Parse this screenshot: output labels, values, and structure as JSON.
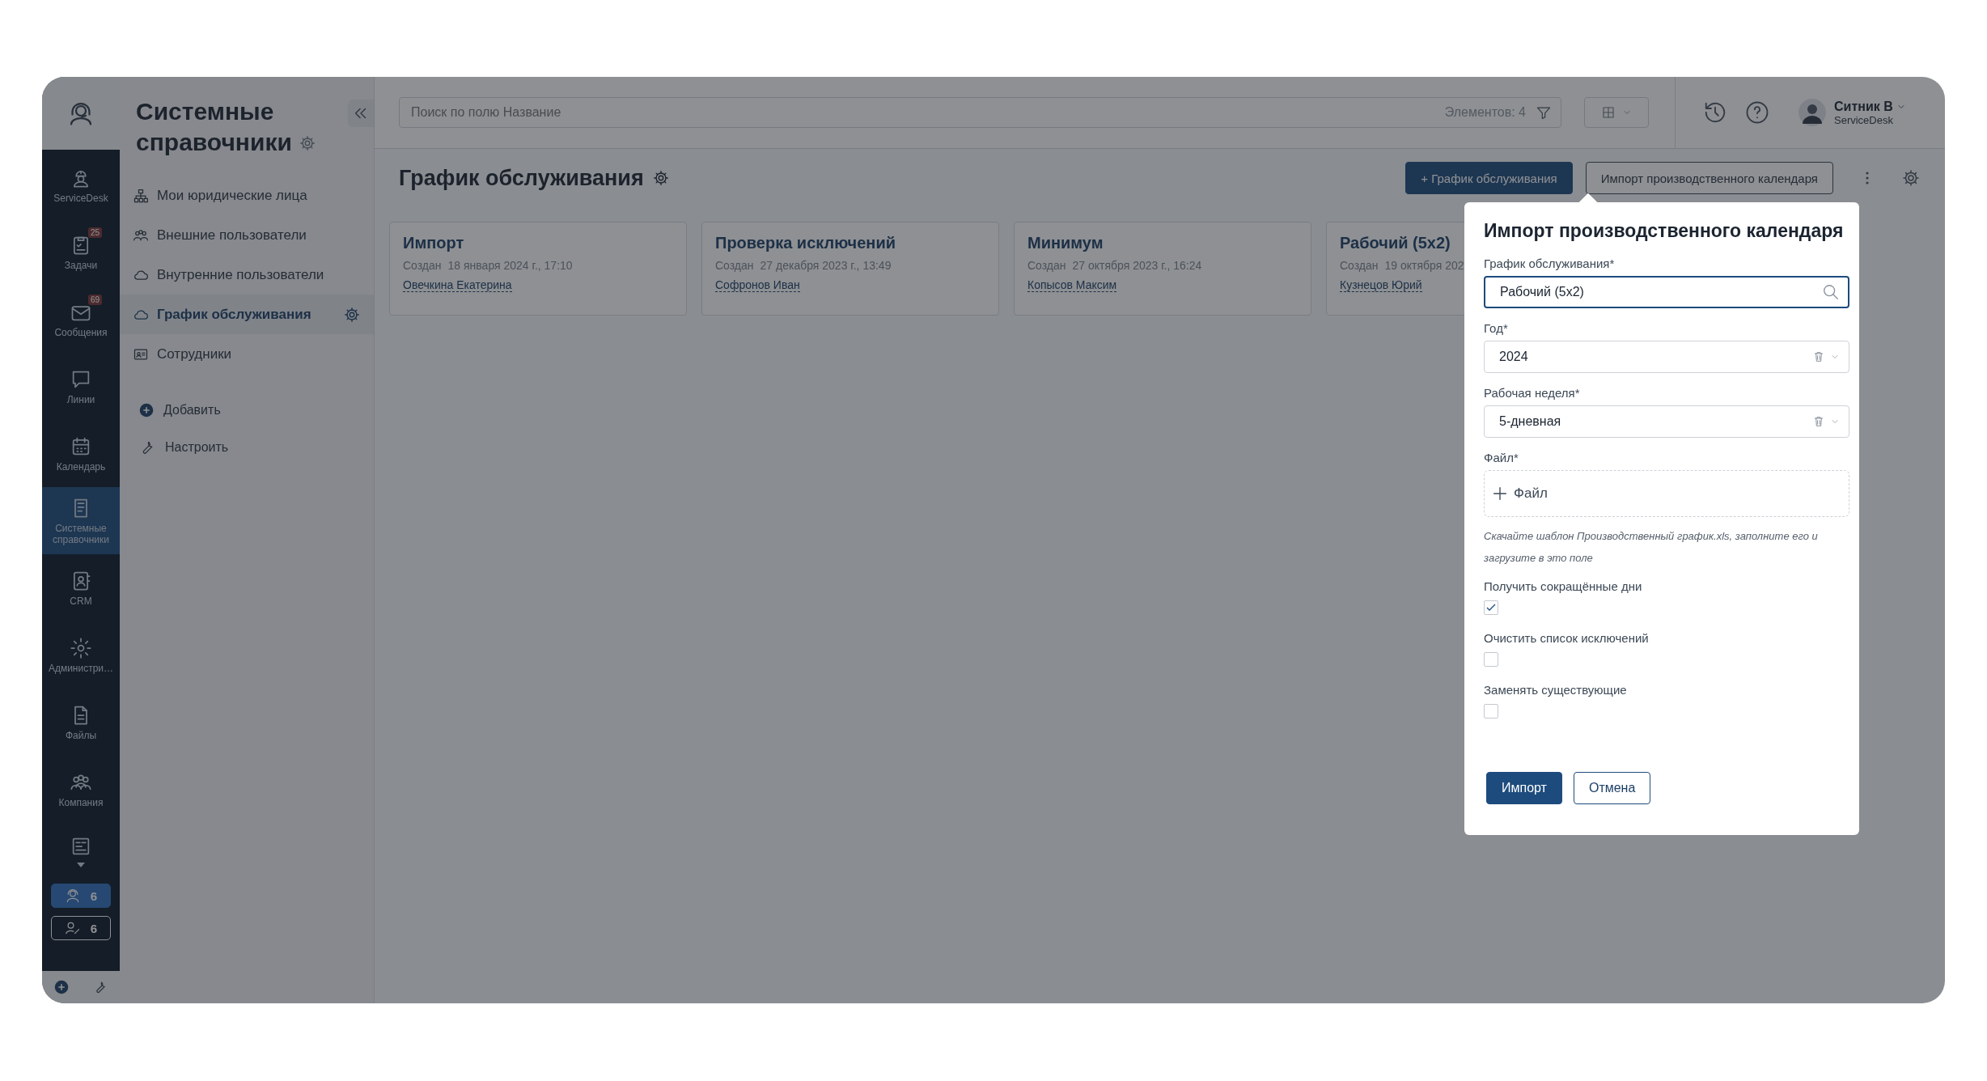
{
  "nav": {
    "items": [
      {
        "label": "ServiceDesk",
        "selected": false
      },
      {
        "label": "Задачи",
        "badge": "25",
        "selected": false
      },
      {
        "label": "Сообщения",
        "badge": "69",
        "selected": false
      },
      {
        "label": "Линии",
        "selected": false
      },
      {
        "label": "Календарь",
        "selected": false
      },
      {
        "label": "Системные справочники",
        "selected": true
      },
      {
        "label": "CRM",
        "selected": false
      },
      {
        "label": "Администри…",
        "selected": false
      },
      {
        "label": "Файлы",
        "selected": false
      },
      {
        "label": "Компания",
        "selected": false
      }
    ],
    "counters": [
      {
        "value": "6",
        "active": true
      },
      {
        "value": "6",
        "active": false
      }
    ]
  },
  "sidebar": {
    "title": "Системные справочники",
    "items": [
      {
        "label": "Мои юридические лица",
        "selected": false
      },
      {
        "label": "Внешние пользователи",
        "selected": false
      },
      {
        "label": "Внутренние пользователи",
        "selected": false
      },
      {
        "label": "График обслуживания",
        "selected": true
      },
      {
        "label": "Сотрудники",
        "selected": false
      }
    ],
    "actions": [
      {
        "label": "Добавить"
      },
      {
        "label": "Настроить"
      }
    ]
  },
  "topbar": {
    "search": {
      "placeholder": "Поиск по полю Название"
    },
    "count": "Элементов: 4",
    "user": {
      "name": "Ситник В",
      "role": "ServiceDesk"
    }
  },
  "page": {
    "title": "График обслуживания",
    "buttons": [
      {
        "label": "+ График обслуживания",
        "kind": "primary"
      },
      {
        "label": "Импорт производственного календаря",
        "kind": "secondary"
      }
    ]
  },
  "cards": [
    {
      "title": "Импорт",
      "created_label": "Создан",
      "created": "18 января 2024 г., 17:10",
      "author": "Овечкина Екатерина"
    },
    {
      "title": "Проверка исключений",
      "created_label": "Создан",
      "created": "27 декабря 2023 г., 13:49",
      "author": "Софронов Иван"
    },
    {
      "title": "Минимум",
      "created_label": "Создан",
      "created": "27 октября 2023 г., 16:24",
      "author": "Копысов Максим"
    },
    {
      "title": "Рабочий (5x2)",
      "created_label": "Создан",
      "created": "19 октября 202",
      "author": "Кузнецов Юрий"
    }
  ],
  "dialog": {
    "title": "Импорт производственного календаря",
    "fields": [
      {
        "label": "График обслуживания*",
        "value": "Рабочий (5x2)",
        "kind": "search",
        "focused": true
      },
      {
        "label": "Год*",
        "value": "2024",
        "kind": "select",
        "focused": false
      },
      {
        "label": "Рабочая неделя*",
        "value": "5-дневная",
        "kind": "select",
        "focused": false
      },
      {
        "label": "Файл*",
        "value": "Файл",
        "kind": "file",
        "focused": false
      }
    ],
    "hint": "Скачайте шаблон Производственный график.xls, заполните его и загрузите в это поле",
    "checkboxes": [
      {
        "label": "Получить сокращённые дни",
        "checked": true
      },
      {
        "label": "Очистить список исключений",
        "checked": false
      },
      {
        "label": "Заменять существующие",
        "checked": false
      }
    ],
    "buttons": [
      {
        "label": "Импорт",
        "kind": "primary"
      },
      {
        "label": "Отмена",
        "kind": "secondary"
      }
    ]
  }
}
